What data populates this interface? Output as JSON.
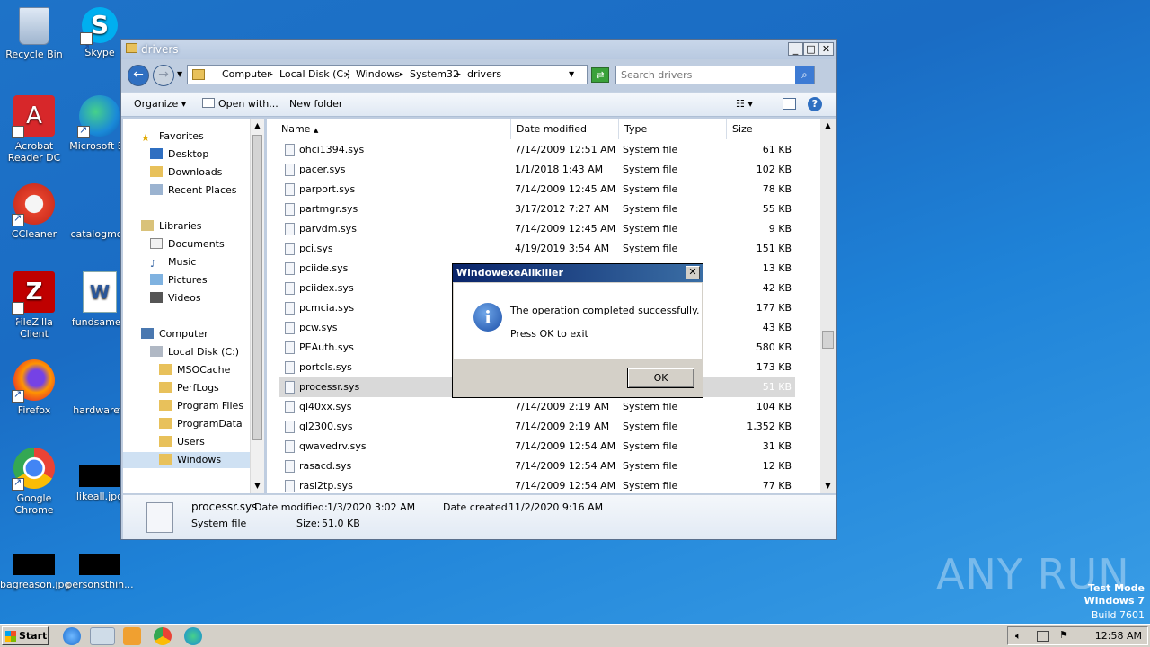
{
  "desktop": {
    "icons": [
      {
        "label": "Recycle Bin",
        "icon": "recycle-bin-icon"
      },
      {
        "label": "Skype",
        "icon": "skype-icon"
      },
      {
        "label": "Acrobat Reader DC",
        "icon": "acrobat-icon"
      },
      {
        "label": "Microsoft Ed",
        "icon": "edge-icon"
      },
      {
        "label": "CCleaner",
        "icon": "ccleaner-icon"
      },
      {
        "label": "catalogmod",
        "icon": "blank-file-icon"
      },
      {
        "label": "FileZilla Client",
        "icon": "filezilla-icon"
      },
      {
        "label": "fundsameri",
        "icon": "word-doc-icon"
      },
      {
        "label": "Firefox",
        "icon": "firefox-icon"
      },
      {
        "label": "hardwaret.",
        "icon": "blank-file-icon"
      },
      {
        "label": "Google Chrome",
        "icon": "chrome-icon"
      },
      {
        "label": "likeall.jpg",
        "icon": "image-thumb-icon"
      },
      {
        "label": "bagreason.jpg",
        "icon": "image-thumb-icon"
      },
      {
        "label": "personsthin...",
        "icon": "image-thumb-icon"
      }
    ],
    "watermark": "ANY RUN",
    "test_mode": {
      "line1": "Test Mode",
      "line2": "Windows 7",
      "line3": "Build 7601"
    }
  },
  "explorer": {
    "title": "drivers",
    "breadcrumbs": [
      "Computer",
      "Local Disk (C:)",
      "Windows",
      "System32",
      "drivers"
    ],
    "search_placeholder": "Search drivers",
    "toolbar": {
      "organize": "Organize",
      "open_with": "Open with...",
      "new_folder": "New folder"
    },
    "nav": {
      "favorites": "Favorites",
      "desktop": "Desktop",
      "downloads": "Downloads",
      "recent": "Recent Places",
      "libraries": "Libraries",
      "documents": "Documents",
      "music": "Music",
      "pictures": "Pictures",
      "videos": "Videos",
      "computer": "Computer",
      "local_disk": "Local Disk (C:)",
      "folders": [
        "MSOCache",
        "PerfLogs",
        "Program Files",
        "ProgramData",
        "Users",
        "Windows"
      ]
    },
    "columns": {
      "name": "Name",
      "date": "Date modified",
      "type": "Type",
      "size": "Size"
    },
    "files": [
      {
        "name": "ohci1394.sys",
        "date": "7/14/2009 12:51 AM",
        "type": "System file",
        "size": "61 KB"
      },
      {
        "name": "pacer.sys",
        "date": "1/1/2018 1:43 AM",
        "type": "System file",
        "size": "102 KB"
      },
      {
        "name": "parport.sys",
        "date": "7/14/2009 12:45 AM",
        "type": "System file",
        "size": "78 KB"
      },
      {
        "name": "partmgr.sys",
        "date": "3/17/2012 7:27 AM",
        "type": "System file",
        "size": "55 KB"
      },
      {
        "name": "parvdm.sys",
        "date": "7/14/2009 12:45 AM",
        "type": "System file",
        "size": "9 KB"
      },
      {
        "name": "pci.sys",
        "date": "4/19/2019 3:54 AM",
        "type": "System file",
        "size": "151 KB"
      },
      {
        "name": "pciide.sys",
        "date": "",
        "type": "",
        "size": "13 KB"
      },
      {
        "name": "pciidex.sys",
        "date": "",
        "type": "",
        "size": "42 KB"
      },
      {
        "name": "pcmcia.sys",
        "date": "",
        "type": "",
        "size": "177 KB"
      },
      {
        "name": "pcw.sys",
        "date": "",
        "type": "",
        "size": "43 KB"
      },
      {
        "name": "PEAuth.sys",
        "date": "",
        "type": "",
        "size": "580 KB"
      },
      {
        "name": "portcls.sys",
        "date": "",
        "type": "",
        "size": "173 KB"
      },
      {
        "name": "processr.sys",
        "date": "",
        "type": "",
        "size": "51 KB"
      },
      {
        "name": "ql40xx.sys",
        "date": "7/14/2009 2:19 AM",
        "type": "System file",
        "size": "104 KB"
      },
      {
        "name": "ql2300.sys",
        "date": "7/14/2009 2:19 AM",
        "type": "System file",
        "size": "1,352 KB"
      },
      {
        "name": "qwavedrv.sys",
        "date": "7/14/2009 12:54 AM",
        "type": "System file",
        "size": "31 KB"
      },
      {
        "name": "rasacd.sys",
        "date": "7/14/2009 12:54 AM",
        "type": "System file",
        "size": "12 KB"
      },
      {
        "name": "rasl2tp.sys",
        "date": "7/14/2009 12:54 AM",
        "type": "System file",
        "size": "77 KB"
      }
    ],
    "details": {
      "filename": "processr.sys",
      "modified_label": "Date modified:",
      "modified_value": "1/3/2020 3:02 AM",
      "created_label": "Date created:",
      "created_value": "11/2/2020 9:16 AM",
      "type": "System file",
      "size_label": "Size:",
      "size_value": "51.0 KB"
    }
  },
  "dialog": {
    "title": "WindowexeAllkiller",
    "message": "The operation completed successfully.",
    "submessage": "Press OK to exit",
    "ok_label": "OK"
  },
  "taskbar": {
    "start_label": "Start",
    "clock": "12:58 AM"
  }
}
